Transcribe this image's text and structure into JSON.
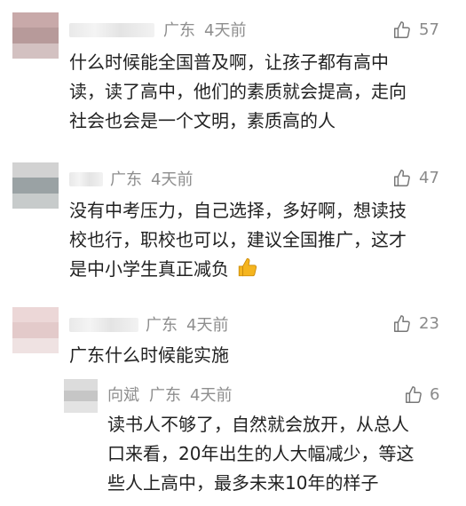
{
  "comments": [
    {
      "location": "广东",
      "time": "4天前",
      "likes": "57",
      "lines": [
        "什么时候能全国普及啊，让孩子都有高中",
        "读，读了高中，他们的素质就会提高，走向",
        "社会也会是一个文明，素质高的人"
      ]
    },
    {
      "location": "广东",
      "time": "4天前",
      "likes": "47",
      "lines": [
        "没有中考压力，自己选择，多好啊，想读技",
        "校也行，职校也可以，建议全国推广，这才",
        "是中小学生真正减负"
      ]
    },
    {
      "location": "广东",
      "time": "4天前",
      "likes": "23",
      "lines": [
        "广东什么时候能实施"
      ]
    }
  ],
  "reply": {
    "username": "向斌",
    "location": "广东",
    "time": "4天前",
    "likes": "6",
    "lines": [
      "读书人不够了，自然就会放开，从总人",
      "口来看，20年出生的人大幅减少，等这",
      "些人上高中，最多未来10年的样子"
    ]
  },
  "icons": {
    "like": "thumbs-up-outline-icon",
    "emoji": "thumbs-up-emoji-icon"
  },
  "colors": {
    "meta": "#8e8e8e",
    "text": "#222222",
    "emoji": "#f5b51f"
  }
}
